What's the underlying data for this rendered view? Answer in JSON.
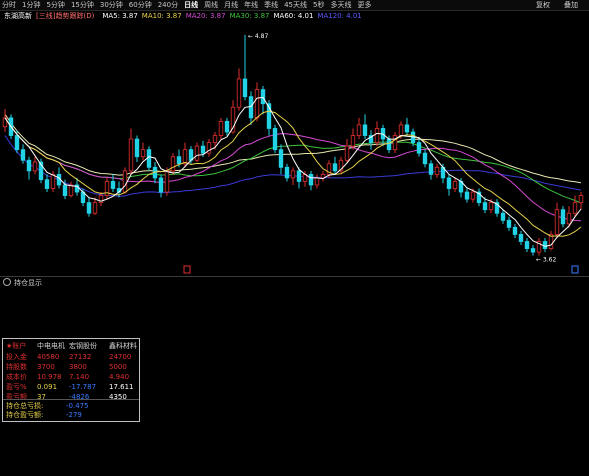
{
  "toolbar": {
    "periods": [
      "分时",
      "1分钟",
      "5分钟",
      "15分钟",
      "30分钟",
      "60分钟",
      "240分",
      "日线",
      "周线",
      "月线",
      "年线",
      "季线",
      "45天线",
      "5秒",
      "多天线",
      "更多"
    ],
    "active_period": "日线",
    "right_label_1": "复权",
    "right_label_2": "叠加"
  },
  "legend": {
    "stock_name": "东湖高新",
    "indicator": "[三线]趋势跟踪(D)",
    "ma_items": [
      {
        "label": "MA5: 3.87",
        "color": "#ffffff"
      },
      {
        "label": "MA10: 3.87",
        "color": "#e8d24a"
      },
      {
        "label": "MA20: 3.87",
        "color": "#d64ad6"
      },
      {
        "label": "MA30: 3.87",
        "color": "#3cc43c"
      },
      {
        "label": "MA60: 4.01",
        "color": "#ffffff"
      },
      {
        "label": "MA120: 4.01",
        "color": "#5a5aff"
      }
    ]
  },
  "chart_data": {
    "type": "candlestick",
    "high_label": "4.87",
    "low_label": "3.62",
    "colors": {
      "up": "#e03030",
      "down": "#22d3e6",
      "ma5": "#ffffff",
      "ma10": "#e8d24a",
      "ma20": "#d64ad6",
      "ma30": "#3cc43c",
      "ma60": "#e8e8b0",
      "ma120": "#3a3ad8"
    },
    "candles": [
      [
        4.35,
        4.4,
        4.45,
        4.32
      ],
      [
        4.4,
        4.3,
        4.42,
        4.28
      ],
      [
        4.3,
        4.22,
        4.33,
        4.2
      ],
      [
        4.22,
        4.16,
        4.25,
        4.14
      ],
      [
        4.16,
        4.1,
        4.18,
        4.05
      ],
      [
        4.1,
        4.15,
        4.18,
        4.08
      ],
      [
        4.15,
        4.05,
        4.17,
        4.03
      ],
      [
        4.05,
        4.0,
        4.08,
        3.98
      ],
      [
        4.0,
        4.08,
        4.1,
        3.98
      ],
      [
        4.08,
        4.02,
        4.12,
        4.0
      ],
      [
        4.02,
        3.96,
        4.05,
        3.94
      ],
      [
        3.96,
        4.02,
        4.04,
        3.95
      ],
      [
        4.02,
        3.98,
        4.06,
        3.96
      ],
      [
        3.98,
        3.92,
        4.0,
        3.9
      ],
      [
        3.92,
        3.86,
        3.95,
        3.84
      ],
      [
        3.86,
        3.92,
        3.95,
        3.85
      ],
      [
        3.92,
        3.96,
        3.98,
        3.9
      ],
      [
        3.96,
        4.04,
        4.06,
        3.94
      ],
      [
        4.04,
        4.0,
        4.08,
        3.98
      ],
      [
        4.0,
        3.98,
        4.04,
        3.95
      ],
      [
        3.98,
        4.1,
        4.12,
        3.97
      ],
      [
        4.1,
        4.28,
        4.34,
        4.08
      ],
      [
        4.28,
        4.18,
        4.3,
        4.15
      ],
      [
        4.18,
        4.22,
        4.26,
        4.16
      ],
      [
        4.22,
        4.12,
        4.24,
        4.1
      ],
      [
        4.12,
        4.06,
        4.15,
        4.03
      ],
      [
        4.06,
        3.98,
        4.08,
        3.95
      ],
      [
        3.98,
        4.1,
        4.12,
        3.96
      ],
      [
        4.1,
        4.18,
        4.2,
        4.08
      ],
      [
        4.18,
        4.14,
        4.22,
        4.12
      ],
      [
        4.14,
        4.22,
        4.26,
        4.12
      ],
      [
        4.22,
        4.16,
        4.24,
        4.14
      ],
      [
        4.16,
        4.24,
        4.26,
        4.15
      ],
      [
        4.24,
        4.2,
        4.27,
        4.18
      ],
      [
        4.2,
        4.26,
        4.28,
        4.18
      ],
      [
        4.26,
        4.3,
        4.32,
        4.22
      ],
      [
        4.3,
        4.38,
        4.4,
        4.28
      ],
      [
        4.38,
        4.32,
        4.4,
        4.3
      ],
      [
        4.32,
        4.46,
        4.5,
        4.31
      ],
      [
        4.46,
        4.62,
        4.68,
        4.44
      ],
      [
        4.62,
        4.52,
        4.87,
        4.5
      ],
      [
        4.52,
        4.4,
        4.55,
        4.36
      ],
      [
        4.4,
        4.56,
        4.6,
        4.38
      ],
      [
        4.56,
        4.48,
        4.58,
        4.42
      ],
      [
        4.48,
        4.34,
        4.5,
        4.3
      ],
      [
        4.34,
        4.22,
        4.36,
        4.2
      ],
      [
        4.22,
        4.12,
        4.25,
        4.08
      ],
      [
        4.12,
        4.06,
        4.14,
        4.04
      ],
      [
        4.06,
        4.1,
        4.12,
        4.02
      ],
      [
        4.1,
        4.04,
        4.12,
        4.0
      ],
      [
        4.04,
        4.08,
        4.1,
        4.01
      ],
      [
        4.08,
        4.02,
        4.1,
        3.99
      ],
      [
        4.02,
        4.06,
        4.08,
        4.0
      ],
      [
        4.06,
        4.08,
        4.1,
        4.04
      ],
      [
        4.08,
        4.14,
        4.16,
        4.06
      ],
      [
        4.14,
        4.1,
        4.18,
        4.08
      ],
      [
        4.1,
        4.16,
        4.18,
        4.08
      ],
      [
        4.16,
        4.24,
        4.28,
        4.14
      ],
      [
        4.24,
        4.3,
        4.34,
        4.22
      ],
      [
        4.3,
        4.36,
        4.4,
        4.28
      ],
      [
        4.36,
        4.3,
        4.42,
        4.28
      ],
      [
        4.3,
        4.26,
        4.33,
        4.22
      ],
      [
        4.26,
        4.34,
        4.38,
        4.24
      ],
      [
        4.34,
        4.28,
        4.36,
        4.24
      ],
      [
        4.28,
        4.22,
        4.3,
        4.2
      ],
      [
        4.22,
        4.3,
        4.32,
        4.2
      ],
      [
        4.3,
        4.36,
        4.38,
        4.28
      ],
      [
        4.36,
        4.32,
        4.4,
        4.3
      ],
      [
        4.32,
        4.26,
        4.34,
        4.24
      ],
      [
        4.26,
        4.2,
        4.28,
        4.18
      ],
      [
        4.2,
        4.14,
        4.22,
        4.12
      ],
      [
        4.14,
        4.08,
        4.16,
        4.05
      ],
      [
        4.08,
        4.12,
        4.14,
        4.06
      ],
      [
        4.12,
        4.06,
        4.14,
        4.03
      ],
      [
        4.06,
        4.0,
        4.08,
        3.96
      ],
      [
        4.0,
        4.04,
        4.06,
        3.98
      ],
      [
        4.04,
        3.98,
        4.06,
        3.95
      ],
      [
        3.98,
        3.94,
        4.0,
        3.92
      ],
      [
        3.94,
        3.98,
        4.0,
        3.92
      ],
      [
        3.98,
        3.92,
        4.0,
        3.9
      ],
      [
        3.92,
        3.88,
        3.95,
        3.86
      ],
      [
        3.88,
        3.92,
        3.94,
        3.86
      ],
      [
        3.92,
        3.86,
        3.94,
        3.84
      ],
      [
        3.86,
        3.82,
        3.88,
        3.8
      ],
      [
        3.82,
        3.78,
        3.84,
        3.76
      ],
      [
        3.78,
        3.74,
        3.8,
        3.72
      ],
      [
        3.74,
        3.7,
        3.76,
        3.68
      ],
      [
        3.7,
        3.66,
        3.72,
        3.64
      ],
      [
        3.66,
        3.64,
        3.68,
        3.62
      ],
      [
        3.64,
        3.7,
        3.72,
        3.62
      ],
      [
        3.7,
        3.66,
        3.72,
        3.64
      ],
      [
        3.66,
        3.74,
        3.76,
        3.65
      ],
      [
        3.74,
        3.88,
        3.92,
        3.72
      ],
      [
        3.88,
        3.8,
        3.9,
        3.78
      ],
      [
        3.8,
        3.86,
        3.9,
        3.78
      ],
      [
        3.86,
        3.92,
        3.96,
        3.84
      ],
      [
        3.92,
        3.96,
        3.98,
        3.88
      ]
    ]
  },
  "sub_panel": {
    "title": "持仓显示"
  },
  "holdings": {
    "header": [
      "★账户",
      "中电电机",
      "宏钢股份",
      "鑫科材料"
    ],
    "rows": [
      {
        "label": "投入金",
        "values": [
          "40580",
          "27132",
          "24700"
        ],
        "colors": [
          "#e03030",
          "#e03030",
          "#e03030"
        ]
      },
      {
        "label": "持股数",
        "values": [
          "3700",
          "3800",
          "5000"
        ],
        "colors": [
          "#e03030",
          "#e03030",
          "#e03030"
        ]
      },
      {
        "label": "成本价",
        "values": [
          "10.978",
          "7.140",
          "4.940"
        ],
        "colors": [
          "#e03030",
          "#e03030",
          "#e03030"
        ]
      },
      {
        "label": "盈亏%",
        "values": [
          "0.091",
          "-17.787",
          "17.611"
        ],
        "colors": [
          "#e8d24a",
          "#3a7bff",
          "#ffffff"
        ]
      },
      {
        "label": "盈亏额",
        "values": [
          "37",
          "-4826",
          "4350"
        ],
        "colors": [
          "#e8d24a",
          "#3a7bff",
          "#ffffff"
        ]
      }
    ],
    "label_color": "#e03030",
    "summary": [
      {
        "label": "持仓总亏损:",
        "value": "-0.475",
        "color": "#3a7bff"
      },
      {
        "label": "持仓盈亏额:",
        "value": "-279",
        "color": "#3a7bff"
      }
    ]
  }
}
